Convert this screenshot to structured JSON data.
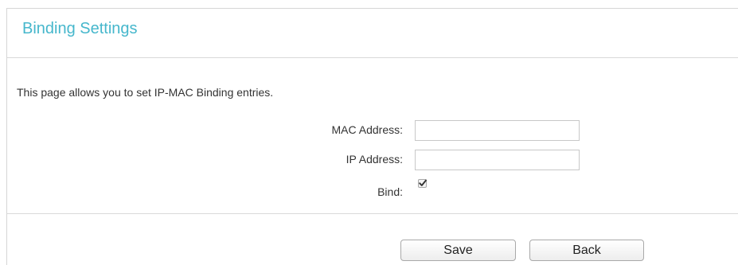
{
  "header": {
    "title": "Binding Settings"
  },
  "description": "This page allows you to set IP-MAC Binding entries.",
  "form": {
    "mac_label": "MAC Address:",
    "mac_value": "",
    "ip_label": "IP Address:",
    "ip_value": "",
    "bind_label": "Bind:",
    "bind_checked": true
  },
  "buttons": {
    "save_label": "Save",
    "back_label": "Back"
  },
  "colors": {
    "title": "#46b7cc",
    "border": "#d6d6d6"
  },
  "icons": {
    "checkmark": "checkmark-icon"
  }
}
